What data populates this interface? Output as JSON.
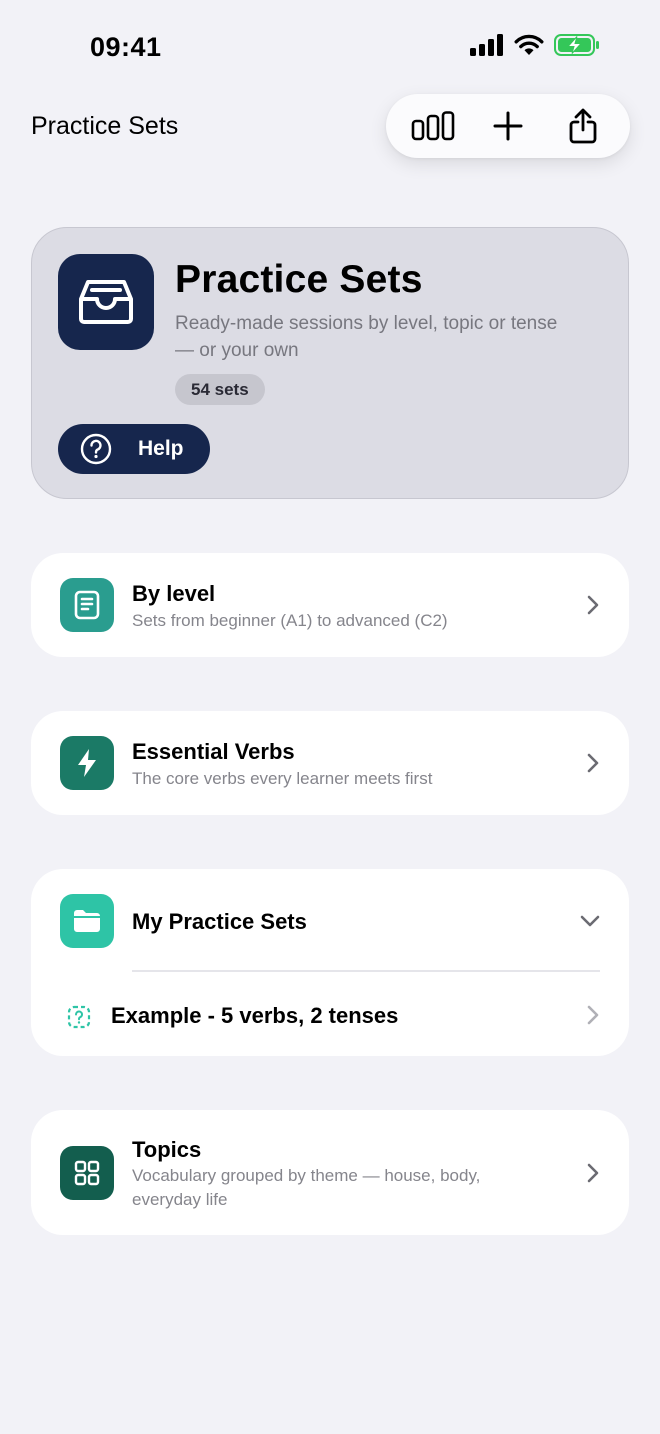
{
  "status_bar": {
    "time": "09:41"
  },
  "nav": {
    "title": "Practice Sets"
  },
  "toolbar": {
    "stats_icon": "bar-chart-icon",
    "add_icon": "plus-icon",
    "share_icon": "share-icon"
  },
  "hero": {
    "icon": "tray-icon",
    "title": "Practice Sets",
    "subtitle": "Ready-made sessions by level, topic or tense — or your own",
    "badge": "54 sets",
    "help_label": "Help"
  },
  "rows": {
    "by_level": {
      "title": "By level",
      "subtitle": "Sets from beginner (A1) to advanced (C2)",
      "icon": "document-icon",
      "color": "#2a9d8f"
    },
    "essential_verbs": {
      "title": "Essential Verbs",
      "subtitle": "The core verbs every learner meets first",
      "icon": "lightning-icon",
      "color": "#1b7a66"
    },
    "my_sets": {
      "title": "My Practice Sets",
      "icon": "folder-icon",
      "color": "#2ec4a6"
    },
    "example_set": {
      "title": "Example - 5 verbs, 2 tenses",
      "icon": "dashed-question-icon"
    },
    "topics": {
      "title": "Topics",
      "subtitle": "Vocabulary grouped by theme — house, body, everyday life",
      "icon": "grid-icon",
      "color": "#135e4e"
    }
  },
  "colors": {
    "accent_navy": "#16264d",
    "background": "#f2f2f7",
    "battery_green": "#34c759"
  }
}
